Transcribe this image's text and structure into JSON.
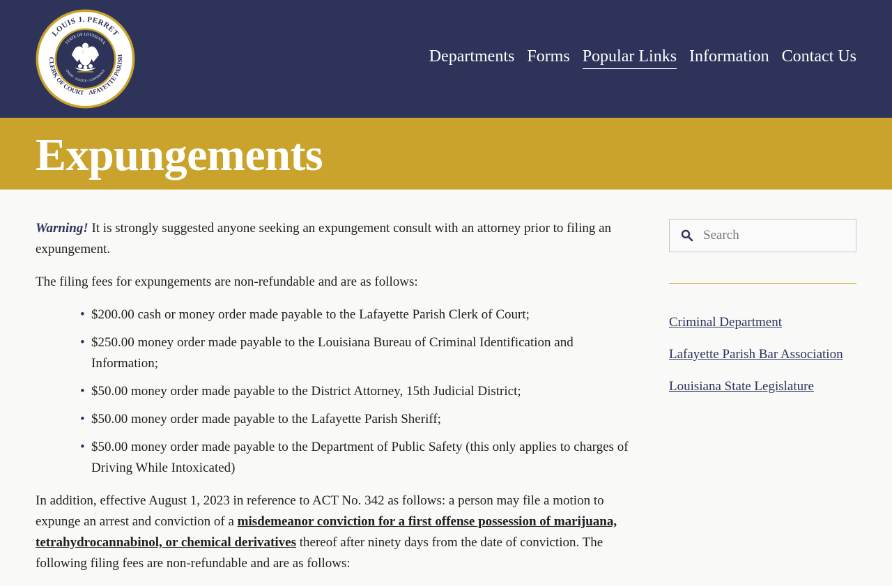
{
  "logo": {
    "top_text": "LOUIS J. PERRET",
    "inner_text": "STATE OF LOUISIANA",
    "motto": "UNION · JUSTICE · CONFIDENCE",
    "left_text": "CLERK OF COURT",
    "right_text": "LAFAYETTE PARISH",
    "colors": {
      "navy": "#2d3359",
      "gold": "#c9a32b"
    }
  },
  "nav": {
    "items": [
      {
        "label": "Departments",
        "active": false
      },
      {
        "label": "Forms",
        "active": false
      },
      {
        "label": "Popular Links",
        "active": true
      },
      {
        "label": "Information",
        "active": false
      },
      {
        "label": "Contact Us",
        "active": false
      }
    ]
  },
  "banner": {
    "title": "Expungements"
  },
  "content": {
    "warning_label": "Warning!",
    "warning_text": " It is strongly suggested anyone seeking an expungement consult with an attorney prior to filing an expungement.",
    "fees_intro": "The filing fees for expungements are non-refundable and are as follows:",
    "fees": [
      "$200.00 cash or money order made payable to the Lafayette Parish Clerk of Court;",
      "$250.00 money order made payable to the Louisiana Bureau of Criminal Identification and Information;",
      "$50.00 money order made payable to the District Attorney, 15th Judicial District;",
      "$50.00 money order made payable to the Lafayette Parish Sheriff;",
      "$50.00 money order made payable to the Department of Public Safety (this only applies to charges of Driving While Intoxicated)"
    ],
    "act_text_1": "In addition, effective August 1, 2023 in reference to ACT No. 342 as follows:  a person may file a motion to expunge an arrest and conviction of a ",
    "act_link": "misdemeanor conviction for a first offense possession of marijuana, tetrahydrocannabinol, or chemical derivatives",
    "act_text_2": " thereof after ninety days from the date of conviction. The following filing fees are non-refundable and are as follows:"
  },
  "sidebar": {
    "search_placeholder": "Search",
    "links": [
      "Criminal Department",
      "Lafayette Parish Bar Association",
      "Louisiana State Legislature"
    ]
  },
  "colors": {
    "header_bg": "#2d3359",
    "banner_bg": "#c9a32b",
    "page_bg": "#f9f9f8",
    "link": "#2d3359"
  }
}
